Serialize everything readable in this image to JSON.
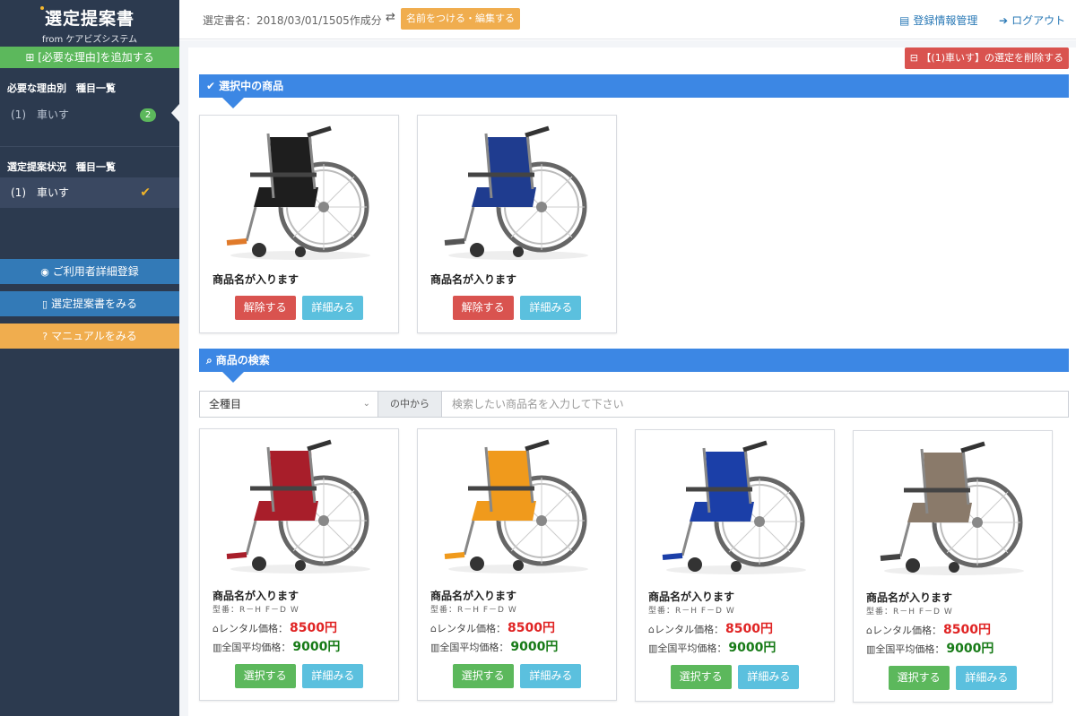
{
  "sidebar": {
    "logo_title": "選定提案書",
    "logo_sub": "from ケアビズシステム",
    "add_reason": "[必要な理由]を追加する",
    "section1_heading": "必要な理由別　種目一覧",
    "section1_item": "(1)　車いす",
    "section1_badge": "2",
    "section2_heading": "選定提案状況　種目一覧",
    "section2_item": "(1)　車いす",
    "btn_user": "ご利用者詳細登録",
    "btn_view": "選定提案書をみる",
    "btn_manual": "マニュアルをみる"
  },
  "topbar": {
    "doc_name": "選定書名：2018/03/01/1505作成分",
    "rename": "名前をつける・編集する",
    "account": "登録情報管理",
    "logout": "ログアウト"
  },
  "main": {
    "delete_selection": "【(1)車いす】の選定を削除する",
    "selected_heading": "選択中の商品",
    "search_heading": "商品の検索",
    "selected_items": [
      {
        "name": "商品名が入ります",
        "release": "解除する",
        "detail": "詳細みる"
      },
      {
        "name": "商品名が入ります",
        "release": "解除する",
        "detail": "詳細みる"
      }
    ],
    "search": {
      "category": "全種目",
      "addon": "の中から",
      "placeholder": "検索したい商品名を入力して下さい"
    },
    "results": [
      {
        "name": "商品名が入ります",
        "model": "型番：R－H F－D W",
        "rental_label": "レンタル価格：",
        "rental_price": "8500円",
        "avg_label": "全国平均価格：",
        "avg_price": "9000円",
        "select": "選択する",
        "detail": "詳細みる"
      },
      {
        "name": "商品名が入ります",
        "model": "型番：R－H F－D W",
        "rental_label": "レンタル価格：",
        "rental_price": "8500円",
        "avg_label": "全国平均価格：",
        "avg_price": "9000円",
        "select": "選択する",
        "detail": "詳細みる"
      },
      {
        "name": "商品名が入ります",
        "model": "型番：R－H F－D W",
        "rental_label": "レンタル価格：",
        "rental_price": "8500円",
        "avg_label": "全国平均価格：",
        "avg_price": "9000円",
        "select": "選択する",
        "detail": "詳細みる"
      },
      {
        "name": "商品名が入ります",
        "model": "型番：R－H F－D W",
        "rental_label": "レンタル価格：",
        "rental_price": "8500円",
        "avg_label": "全国平均価格：",
        "avg_price": "9000円",
        "select": "選択する",
        "detail": "詳細みる"
      }
    ]
  },
  "colors": {
    "sidebar_bg": "#2c3a4f",
    "primary_blue": "#3c87e4",
    "success_green": "#5cb85c",
    "danger_red": "#d9534f",
    "info_cyan": "#5bc0de",
    "warning_orange": "#f0ad4e",
    "price_red": "#e02424",
    "price_green": "#167a16"
  },
  "icons": {
    "add": "plus-square-icon",
    "check": "check-icon",
    "user": "user-circle-icon",
    "doc": "document-icon",
    "help": "question-circle-icon",
    "swap": "swap-icon",
    "account": "id-card-icon",
    "logout": "logout-icon",
    "delete": "minus-square-icon",
    "search": "search-icon",
    "home": "home-icon",
    "chart": "bar-chart-icon",
    "wheelchair": "wheelchair-image"
  }
}
